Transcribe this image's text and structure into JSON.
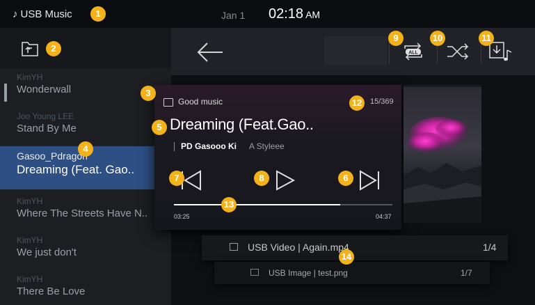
{
  "status": {
    "app_title": "USB Music",
    "date": "Jan 1",
    "time": "02:18",
    "ampm": "AM"
  },
  "sidebar": {
    "songs": [
      {
        "artist": "KimYH",
        "title": "Wonderwall"
      },
      {
        "artist": "Joo Young LEE",
        "title": "Stand By Me"
      },
      {
        "artist": "Gasoo_Pdragon",
        "title": "Dreaming (Feat. Gao.."
      },
      {
        "artist": "KimYH",
        "title": "Where The Streets Have N.."
      },
      {
        "artist": "KimYH",
        "title": "We just don't"
      },
      {
        "artist": "KimYH",
        "title": "There Be Love"
      }
    ]
  },
  "player": {
    "folder": "Good music",
    "counter": "15/369",
    "title": "Dreaming (Feat.Gao..",
    "artist_primary": "PD Gasooo Ki",
    "artist_secondary": "A Styleee",
    "time_elapsed": "03:25",
    "time_total": "04:37",
    "progress": 0.76
  },
  "video_card": {
    "label": "USB Video  |  Again.mp4",
    "count": "1/4"
  },
  "image_card": {
    "label": "USB Image  |  test.png",
    "count": "1/7"
  },
  "badges": [
    "1",
    "2",
    "3",
    "4",
    "5",
    "6",
    "7",
    "8",
    "9",
    "10",
    "11",
    "12",
    "13",
    "14"
  ],
  "colors": {
    "accent": "#f4b21a",
    "selection": "#2d4f83"
  }
}
